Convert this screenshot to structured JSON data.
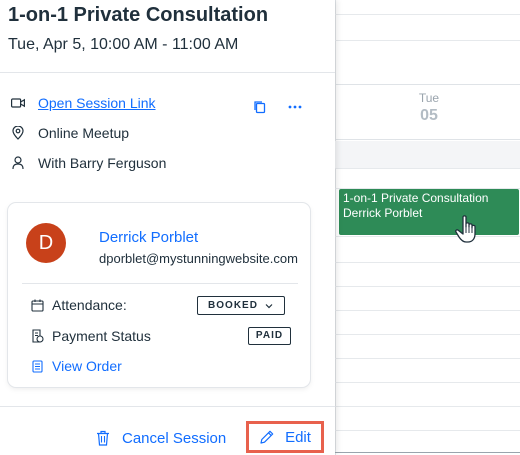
{
  "calendar": {
    "day_name": "Tue",
    "day_number": "05"
  },
  "event": {
    "title": "1-on-1 Private Consultation",
    "customer": "Derrick Porblet",
    "color": "#2e8b57"
  },
  "session": {
    "title": "1-on-1 Private Consultation",
    "datetime": "Tue, Apr 5, 10:00 AM - 11:00 AM",
    "session_link_label": "Open Session Link",
    "location": "Online Meetup",
    "staff": "With Barry Ferguson"
  },
  "customer": {
    "initial": "D",
    "name": "Derrick Porblet",
    "email": "dporblet@mystunningwebsite.com",
    "avatar_color": "#c8411a"
  },
  "details": {
    "attendance_label": "Attendance:",
    "attendance_status": "BOOKED",
    "payment_label": "Payment Status",
    "payment_status": "PAID",
    "view_order_label": "View Order"
  },
  "footer": {
    "cancel_label": "Cancel Session",
    "edit_label": "Edit"
  },
  "icons": {
    "session_link": "video-camera-icon",
    "location": "location-pin-icon",
    "staff": "person-icon",
    "copy": "copy-icon",
    "more": "more-icon",
    "attendance": "calendar-icon",
    "payment": "payment-icon",
    "order": "document-icon",
    "cancel": "trash-icon",
    "edit": "pencil-icon"
  },
  "colors": {
    "accent": "#116dff",
    "highlight": "#e8614d"
  }
}
